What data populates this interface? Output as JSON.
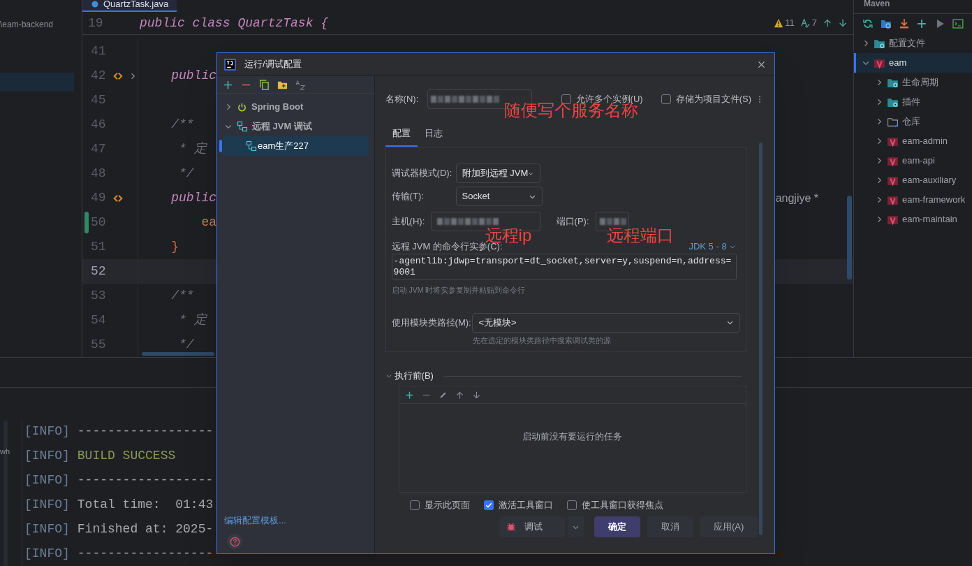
{
  "project_panel": {
    "path": "\\eam-backend"
  },
  "editor": {
    "tab": "QuartzTask.java",
    "sticky": {
      "number": "19",
      "code": "public class QuartzTask {"
    },
    "warnings": "11",
    "typos": "7",
    "lines": [
      {
        "number": "41",
        "marker": false,
        "fold": false,
        "changed": false,
        "current": false
      },
      {
        "number": "42",
        "code": "    public",
        "kind": "keyword",
        "marker": true,
        "fold": true,
        "changed": false,
        "current": false
      },
      {
        "number": "45",
        "marker": false,
        "fold": false,
        "changed": false,
        "current": false
      },
      {
        "number": "46",
        "code": "    /**",
        "kind": "comment",
        "marker": false,
        "fold": false,
        "changed": false,
        "current": false
      },
      {
        "number": "47",
        "code": "     * 定",
        "kind": "comment",
        "marker": false,
        "fold": false,
        "changed": false,
        "current": false
      },
      {
        "number": "48",
        "code": "     */",
        "kind": "comment",
        "marker": false,
        "fold": false,
        "changed": false,
        "current": false
      },
      {
        "number": "49",
        "code": "    public",
        "kind": "keyword",
        "marker": true,
        "fold": false,
        "changed": false,
        "current": false,
        "right_text": "angjiye *"
      },
      {
        "number": "50",
        "code": "        ea",
        "kind": "field",
        "marker": false,
        "fold": false,
        "changed": true,
        "current": false
      },
      {
        "number": "51",
        "code": "    }",
        "kind": "brace",
        "marker": false,
        "fold": false,
        "changed": false,
        "current": false
      },
      {
        "number": "52",
        "marker": false,
        "fold": false,
        "changed": false,
        "current": true
      },
      {
        "number": "53",
        "code": "    /**",
        "kind": "comment",
        "marker": false,
        "fold": false,
        "changed": false,
        "current": false
      },
      {
        "number": "54",
        "code": "     * 定",
        "kind": "comment",
        "marker": false,
        "fold": false,
        "changed": false,
        "current": false
      },
      {
        "number": "55",
        "code": "     */",
        "kind": "comment",
        "marker": false,
        "fold": false,
        "changed": false,
        "current": false
      }
    ]
  },
  "maven": {
    "title": "Maven",
    "tree": [
      {
        "label": "配置文件",
        "kind": "config",
        "expanded": false,
        "selected": false
      },
      {
        "label": "eam",
        "kind": "maven",
        "expanded": true,
        "selected": true,
        "children": [
          {
            "label": "生命周期",
            "kind": "config",
            "expanded": false,
            "selected": false
          },
          {
            "label": "插件",
            "kind": "config",
            "expanded": false,
            "selected": false
          },
          {
            "label": "仓库",
            "kind": "folder",
            "expanded": false,
            "selected": false
          },
          {
            "label": "eam-admin",
            "kind": "maven",
            "expanded": false,
            "selected": false
          },
          {
            "label": "eam-api",
            "kind": "maven",
            "expanded": false,
            "selected": false
          },
          {
            "label": "eam-auxiliary",
            "kind": "maven",
            "expanded": false,
            "selected": false
          },
          {
            "label": "eam-framework",
            "kind": "maven",
            "expanded": false,
            "selected": false
          },
          {
            "label": "eam-maintain",
            "kind": "maven",
            "expanded": false,
            "selected": false
          }
        ]
      }
    ]
  },
  "console": {
    "gutter_text": "wh",
    "lines": [
      {
        "tag": "[INFO]",
        "text": "------------------",
        "kind": "plain"
      },
      {
        "tag": "[INFO]",
        "text": "BUILD SUCCESS",
        "kind": "success"
      },
      {
        "tag": "[INFO]",
        "text": "------------------",
        "kind": "plain"
      },
      {
        "tag": "[INFO]",
        "text": "Total time:  01:43",
        "kind": "plain"
      },
      {
        "tag": "[INFO]",
        "text": "Finished at: 2025-",
        "kind": "plain"
      },
      {
        "tag": "[INFO]",
        "text": "------------------",
        "kind": "plain"
      }
    ]
  },
  "dialog": {
    "title": "运行/调试配置",
    "tree": [
      {
        "label": "Spring Boot",
        "kind": "spring",
        "expanded": false,
        "selected": false
      },
      {
        "label": "远程 JVM 调试",
        "kind": "remote",
        "expanded": true,
        "selected": false,
        "children": [
          {
            "label": "eam生产227",
            "kind": "remote",
            "selected": true
          }
        ]
      }
    ],
    "edit_templates": "编辑配置模板...",
    "name_label": "名称(N):",
    "allow_parallel": {
      "label": "允许多个实例(U)",
      "checked": false
    },
    "store_as_file": {
      "label": "存储为项目文件(S)",
      "checked": false
    },
    "annotations": [
      "随便写个服务名称",
      "远程ip",
      "远程端口"
    ],
    "tabs": [
      {
        "label": "配置",
        "selected": true
      },
      {
        "label": "日志",
        "selected": false
      }
    ],
    "debugger_mode": {
      "label": "调试器模式(D):",
      "value": "附加到远程 JVM"
    },
    "transport": {
      "label": "传输(T):",
      "value": "Socket"
    },
    "host_label": "主机(H):",
    "port_label": "端口(P):",
    "args_label": "远程 JVM 的命令行实参(C):",
    "jdk": "JDK 5 - 8",
    "args": "-agentlib:jdwp=transport=dt_socket,server=y,suspend=n,address=9001",
    "args_hint": "启动 JVM 时将实参复制并粘贴到命令行",
    "module": {
      "label": "使用模块类路径(M):",
      "value": "<无模块>",
      "hint": "先在选定的模块类路径中搜索调试类的源"
    },
    "before_launch": {
      "title": "执行前(B)",
      "expanded": true,
      "empty_text": "启动前没有要运行的任务"
    },
    "options": [
      {
        "label": "显示此页面",
        "checked": false
      },
      {
        "label": "激活工具窗口",
        "checked": true
      },
      {
        "label": "使工具窗口获得焦点",
        "checked": false
      }
    ],
    "buttons": {
      "debug": "调试",
      "ok": "确定",
      "cancel": "取消",
      "apply": "应用(A)"
    }
  }
}
